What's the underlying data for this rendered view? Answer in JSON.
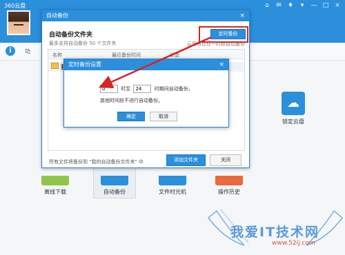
{
  "app": {
    "title": "360云盘",
    "controls": [
      "⌂",
      "✉",
      "♦",
      "▾",
      "—",
      "□",
      "×"
    ]
  },
  "info_bar": {
    "icon": "i",
    "text": "功"
  },
  "lock_tile": {
    "label": "锁定云盘"
  },
  "bottom_tiles": [
    {
      "label": "离线下载"
    },
    {
      "label": "自动备份"
    },
    {
      "label": "文件时光机"
    },
    {
      "label": "操作历史"
    }
  ],
  "watermark": {
    "text": "我爱IT技术网",
    "url": "www.52ij.com"
  },
  "backup_dialog": {
    "title": "自动备份",
    "close": "×",
    "heading": "自动备份文件夹",
    "subtitle": "最多支持自动备份 50 个文件夹",
    "schedule_button": "定时备份",
    "right_note": "云盘将在任一时段自动备份",
    "columns": {
      "name": "名称",
      "last_backup": "最近备份时间",
      "status": "状态"
    },
    "rows": [
      {
        "name": "我"
      }
    ],
    "footnote": "所有文件将备份到 \"我的自动备份文件夹\" 中",
    "add_button": "添加文件夹",
    "close_button": "关闭"
  },
  "schedule_dialog": {
    "title": "定时备份设置",
    "close": "×",
    "from_value": "0",
    "to_label": "时至",
    "to_value": "24",
    "period_label": "时期间自动备份，",
    "note": "其他时间段不进行自动备份。",
    "ok_button": "确定",
    "cancel_button": "取消"
  },
  "colors": {
    "accent": "#2b8fdc",
    "highlight": "#d62323"
  }
}
